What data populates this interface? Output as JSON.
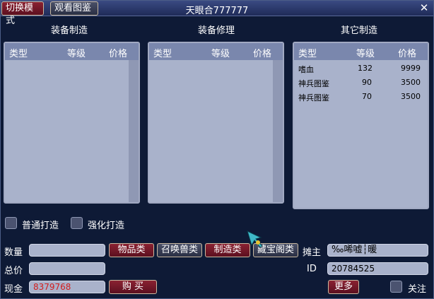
{
  "titlebar": {
    "title": "天眼合777777",
    "switch_mode_label": "切换模式",
    "view_guide_label": "观看图鉴",
    "close_label": "✕"
  },
  "sections": {
    "equip_make": "装备制造",
    "equip_repair": "装备修理",
    "other_make": "其它制造"
  },
  "columns": {
    "type": "类型",
    "level": "等级",
    "price": "价格"
  },
  "other_items": [
    {
      "type": "嗜血",
      "level": "132",
      "price": "9999"
    },
    {
      "type": "神兵图鉴",
      "level": "90",
      "price": "3500"
    },
    {
      "type": "神兵图鉴",
      "level": "70",
      "price": "3500"
    }
  ],
  "options": {
    "normal_forge": "普通打造",
    "enhanced_forge": "强化打造"
  },
  "bottom": {
    "quantity_label": "数量",
    "quantity_value": "",
    "total_label": "总价",
    "total_value": "",
    "cash_label": "现金",
    "cash_value": "8379768",
    "buy_label": "购 买",
    "tabs": [
      "物品类",
      "召唤兽类",
      "制造类",
      "藏宝阁类"
    ],
    "owner_label": "摊主",
    "owner_value": "‰唏嘘┆暖",
    "id_label": "ID",
    "id_value": "20784525",
    "more_label": "更多",
    "follow_label": "关注"
  },
  "colors": {
    "accent_red": "#8a2232",
    "panel_bg": "#a9b2cb",
    "cash_text": "#d21e1e"
  }
}
